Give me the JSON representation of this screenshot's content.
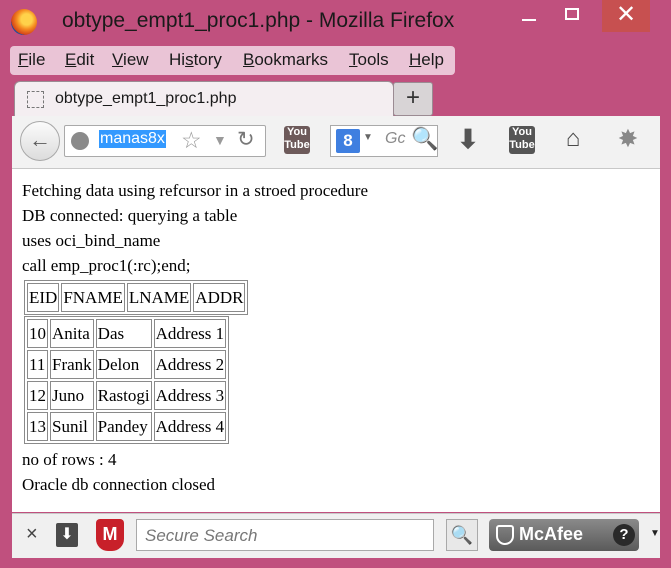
{
  "window": {
    "title": "obtype_empt1_proc1.php - Mozilla Firefox",
    "minimize": "–",
    "close": "✕"
  },
  "menu": [
    {
      "ul": "F",
      "rest": "ile"
    },
    {
      "ul": "E",
      "rest": "dit"
    },
    {
      "ul": "V",
      "rest": "iew"
    },
    {
      "pre": "Hi",
      "ul": "s",
      "rest": "tory"
    },
    {
      "ul": "B",
      "rest": "ookmarks"
    },
    {
      "ul": "T",
      "rest": "ools"
    },
    {
      "ul": "H",
      "rest": "elp"
    }
  ],
  "tab": {
    "label": "obtype_empt1_proc1.php",
    "new_tab": "+"
  },
  "nav": {
    "back": "←",
    "url": "manas8x",
    "star": "☆",
    "dropdown": "▼",
    "reload": "↻",
    "youtube1": "You Tube",
    "search_engine": "8",
    "search_engine_dropdown": "▼",
    "search_placeholder": "Gc",
    "search_go": "🔍",
    "download": "⬇",
    "youtube2": "You Tube",
    "home": "⌂",
    "extension": "✸"
  },
  "content": {
    "lines": [
      "Fetching data using refcursor in a stroed procedure",
      "DB connected: querying a table",
      "uses oci_bind_name",
      "call emp_proc1(:rc);end;"
    ],
    "headers": [
      "EID",
      "FNAME",
      "LNAME",
      "ADDR"
    ],
    "rows": [
      [
        "10",
        "Anita",
        "Das",
        "Address 1"
      ],
      [
        "11",
        "Frank",
        "Delon",
        "Address 2"
      ],
      [
        "12",
        "Juno",
        "Rastogi",
        "Address 3"
      ],
      [
        "13",
        "Sunil",
        "Pandey",
        "Address 4"
      ]
    ],
    "footer_lines": [
      "no of rows : 4",
      "Oracle db connection closed"
    ]
  },
  "bottom": {
    "close": "×",
    "download": "⬇",
    "shield_letter": "M",
    "search_placeholder": "Secure Search",
    "search_go": "🔍",
    "mcafee_label": "McAfee",
    "help": "?",
    "more": "▼"
  }
}
